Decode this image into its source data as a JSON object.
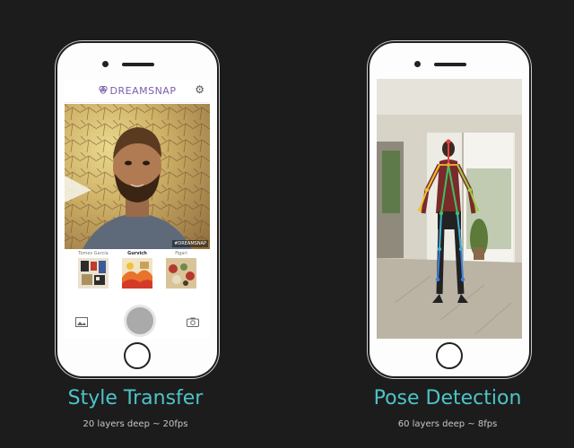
{
  "left_device": {
    "app_name": "DREAMSNAP",
    "watermark": "#DREAMSNAP",
    "styles": [
      {
        "label": "Tomes García",
        "active": false
      },
      {
        "label": "Gurvich",
        "active": true
      },
      {
        "label": "Figari",
        "active": false
      }
    ],
    "title": "Style Transfer",
    "subtitle": "20 layers deep ~ 20fps"
  },
  "right_device": {
    "title": "Pose Detection",
    "subtitle": "60 layers deep ~ 8fps"
  },
  "colors": {
    "background": "#1c1c1c",
    "accent": "#4cc4c8",
    "brand": "#7b5fa9"
  }
}
